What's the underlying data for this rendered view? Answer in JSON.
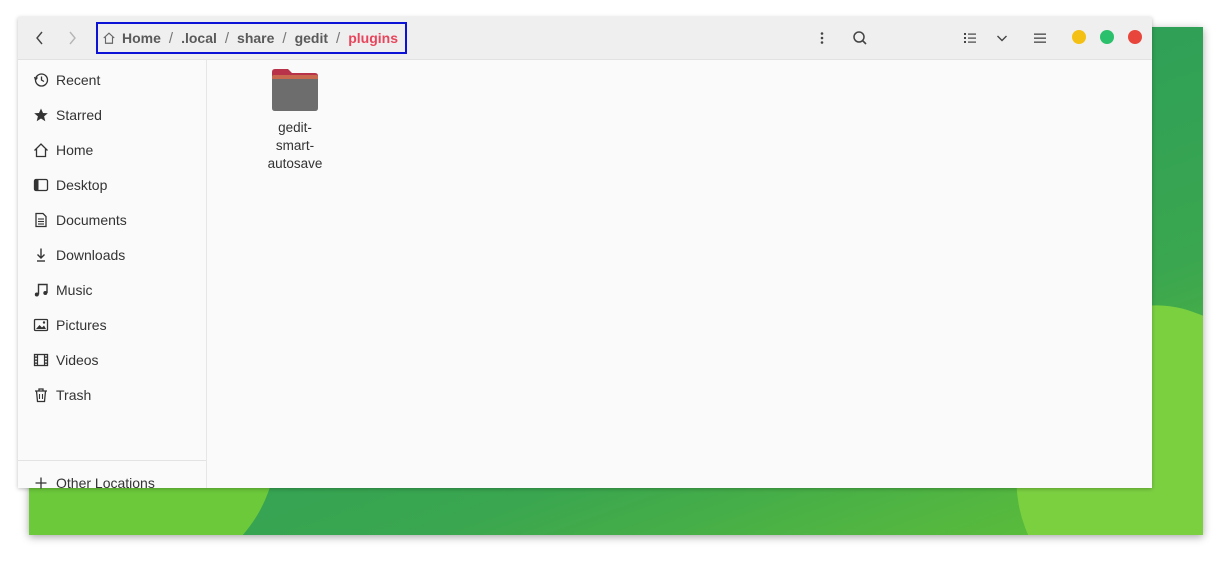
{
  "breadcrumb": {
    "items": [
      "Home",
      ".local",
      "share",
      "gedit",
      "plugins"
    ],
    "separator": "/"
  },
  "header": {
    "back_icon": "chevron-left-icon",
    "forward_icon": "chevron-right-icon",
    "more_icon": "vertical-dots-icon",
    "search_icon": "search-icon",
    "view_icon": "list-view-icon",
    "view_menu_icon": "chevron-down-icon",
    "menu_icon": "hamburger-icon"
  },
  "window_controls": {
    "minimize_color": "#f4c013",
    "maximize_color": "#2bc06b",
    "close_color": "#e8463c"
  },
  "sidebar": {
    "items": [
      {
        "label": "Recent",
        "icon": "clock-icon"
      },
      {
        "label": "Starred",
        "icon": "star-icon"
      },
      {
        "label": "Home",
        "icon": "home-icon"
      },
      {
        "label": "Desktop",
        "icon": "desktop-icon"
      },
      {
        "label": "Documents",
        "icon": "document-icon"
      },
      {
        "label": "Downloads",
        "icon": "download-icon"
      },
      {
        "label": "Music",
        "icon": "music-icon"
      },
      {
        "label": "Pictures",
        "icon": "picture-icon"
      },
      {
        "label": "Videos",
        "icon": "video-icon"
      },
      {
        "label": "Trash",
        "icon": "trash-icon"
      }
    ],
    "other_locations": {
      "label": "Other Locations",
      "icon": "plus-icon"
    }
  },
  "content": {
    "files": [
      {
        "name_lines": [
          "gedit-",
          "smart-",
          "autosave"
        ],
        "type": "folder",
        "icon": "folder-icon"
      }
    ]
  },
  "colors": {
    "accent": "#e8455c",
    "highlight_border": "#0d13d6"
  }
}
